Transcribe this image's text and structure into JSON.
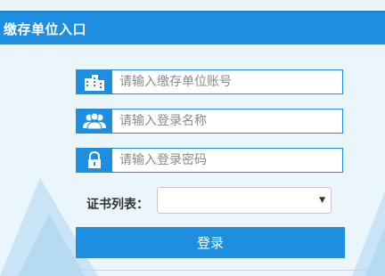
{
  "header": {
    "title": "缴存单位入口"
  },
  "form": {
    "account": {
      "placeholder": "请输入缴存单位账号",
      "value": "",
      "icon": "building-icon"
    },
    "login_name": {
      "placeholder": "请输入登录名称",
      "value": "",
      "icon": "users-icon"
    },
    "password": {
      "placeholder": "请输入登录密码",
      "value": "",
      "icon": "lock-icon"
    },
    "certificate": {
      "label": "证书列表：",
      "selected": ""
    },
    "submit_label": "登录"
  },
  "colors": {
    "accent": "#1e8fe0",
    "background": "#eaf5fc"
  }
}
